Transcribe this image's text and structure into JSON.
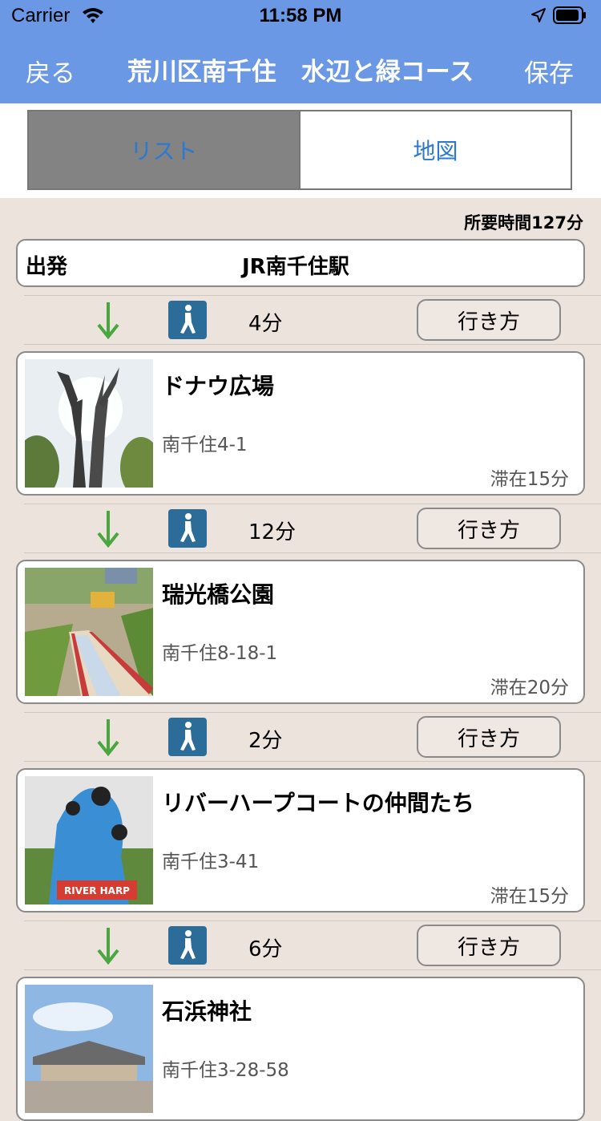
{
  "status": {
    "carrier": "Carrier",
    "time": "11:58 PM"
  },
  "nav": {
    "back_label": "戻る",
    "title": "荒川区南千住　水辺と緑コース",
    "save_label": "保存"
  },
  "tabs": {
    "list_label": "リスト",
    "map_label": "地図"
  },
  "course": {
    "total_time": "所要時間127分",
    "start_label": "出発",
    "start_station": "JR南千住駅"
  },
  "steps": [
    {
      "time": "4分",
      "route_label": "行き方"
    },
    {
      "time": "12分",
      "route_label": "行き方"
    },
    {
      "time": "2分",
      "route_label": "行き方"
    },
    {
      "time": "6分",
      "route_label": "行き方"
    }
  ],
  "spots": [
    {
      "name": "ドナウ広場",
      "address": "南千住4-1",
      "stay": "滞在15分"
    },
    {
      "name": "瑞光橋公園",
      "address": "南千住8-18-1",
      "stay": "滞在20分"
    },
    {
      "name": "リバーハープコートの仲間たち",
      "address": "南千住3-41",
      "stay": "滞在15分",
      "photo_sign": "RIVER HARP"
    },
    {
      "name": "石浜神社",
      "address": "南千住3-28-58",
      "stay": ""
    }
  ],
  "colors": {
    "nav_bg": "#6a98e4",
    "page_bg": "#ece3dd",
    "walk_icon_bg": "#2c6c98",
    "arrow_green": "#4aa63e",
    "tab_text": "#2d79d1"
  }
}
